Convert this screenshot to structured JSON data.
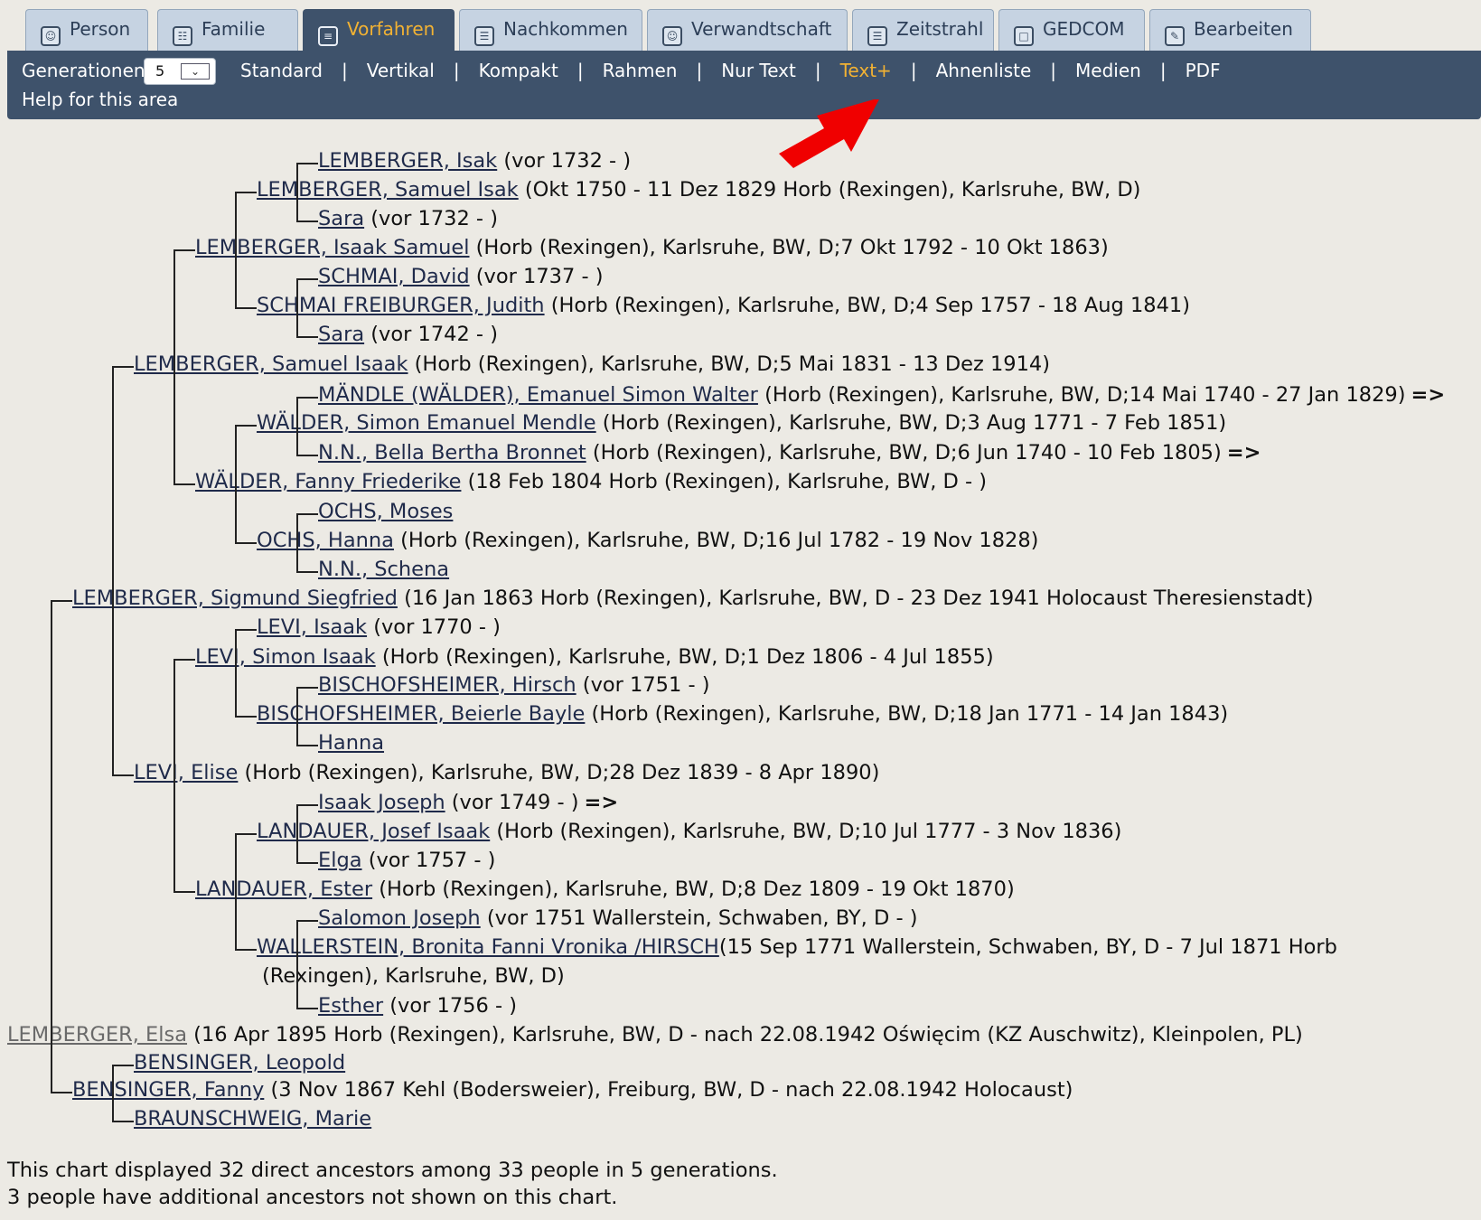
{
  "tabs": [
    {
      "label": "Person",
      "icon": "person-icon",
      "glyph": "☺"
    },
    {
      "label": "Familie",
      "icon": "family-icon",
      "glyph": "☷"
    },
    {
      "label": "Vorfahren",
      "icon": "ancestors-icon",
      "glyph": "≡"
    },
    {
      "label": "Nachkommen",
      "icon": "descendants-icon",
      "glyph": "☰"
    },
    {
      "label": "Verwandtschaft",
      "icon": "relationship-icon",
      "glyph": "☺"
    },
    {
      "label": "Zeitstrahl",
      "icon": "timeline-icon",
      "glyph": "☰"
    },
    {
      "label": "GEDCOM",
      "icon": "gedcom-icon",
      "glyph": "□"
    },
    {
      "label": "Bearbeiten",
      "icon": "edit-icon",
      "glyph": "✎"
    }
  ],
  "active_tab": "Vorfahren",
  "toolbar": {
    "generations_label": "Generationen:",
    "generations_value": "5",
    "views": [
      "Standard",
      "Vertikal",
      "Kompakt",
      "Rahmen",
      "Nur Text",
      "Text+",
      "Ahnenliste",
      "Medien",
      "PDF"
    ],
    "selected_view": "Text+",
    "separator": "|",
    "help": "Help for this area"
  },
  "colors": {
    "tab_bg": "#c6d3e2",
    "active_tab_bg": "#3e526b",
    "active_text": "#f2b233",
    "toolbar_bg": "#3e526b",
    "arrow": "#f00000"
  },
  "tree": [
    {
      "name": "LEMBERGER, Isak",
      "info": " (vor 1732 - )"
    },
    {
      "name": "LEMBERGER, Samuel Isak",
      "info": " (Okt 1750 - 11 Dez 1829 Horb (Rexingen), Karlsruhe, BW, D)"
    },
    {
      "name": "Sara",
      "info": " (vor 1732 - )"
    },
    {
      "name": "LEMBERGER, Isaak Samuel",
      "info": " (Horb (Rexingen), Karlsruhe, BW, D;7 Okt 1792 - 10 Okt 1863)"
    },
    {
      "name": "SCHMAI, David",
      "info": " (vor 1737 - )"
    },
    {
      "name": "SCHMAI FREIBURGER, Judith",
      "info": " (Horb (Rexingen), Karlsruhe, BW, D;4 Sep 1757 - 18 Aug 1841)"
    },
    {
      "name": "Sara",
      "info": " (vor 1742 - )"
    },
    {
      "name": "LEMBERGER, Samuel Isaak",
      "info": " (Horb (Rexingen), Karlsruhe, BW, D;5 Mai 1831 - 13 Dez 1914)"
    },
    {
      "name": "MÄNDLE (WÄLDER), Emanuel Simon Walter",
      "info": " (Horb (Rexingen), Karlsruhe, BW, D;14 Mai 1740 - 27 Jan 1829)",
      "more": "=>"
    },
    {
      "name": "WÄLDER, Simon Emanuel Mendle",
      "info": " (Horb (Rexingen), Karlsruhe, BW, D;3 Aug 1771 - 7 Feb 1851)"
    },
    {
      "name": "N.N., Bella Bertha Bronnet",
      "info": " (Horb (Rexingen), Karlsruhe, BW, D;6 Jun 1740 - 10 Feb 1805)",
      "more": "=>"
    },
    {
      "name": "WÄLDER, Fanny Friederike",
      "info": " (18 Feb 1804 Horb (Rexingen), Karlsruhe, BW, D - )"
    },
    {
      "name": "OCHS, Moses",
      "info": ""
    },
    {
      "name": "OCHS, Hanna",
      "info": " (Horb (Rexingen), Karlsruhe, BW, D;16 Jul 1782 - 19 Nov 1828)"
    },
    {
      "name": "N.N., Schena",
      "info": ""
    },
    {
      "name": "LEMBERGER, Sigmund Siegfried",
      "info": " (16 Jan 1863 Horb (Rexingen), Karlsruhe, BW, D - 23 Dez 1941 Holocaust Theresienstadt)"
    },
    {
      "name": "LEVI, Isaak",
      "info": " (vor 1770 - )"
    },
    {
      "name": "LEVI, Simon Isaak",
      "info": " (Horb (Rexingen), Karlsruhe, BW, D;1 Dez 1806 - 4 Jul 1855)"
    },
    {
      "name": "BISCHOFSHEIMER, Hirsch",
      "info": " (vor 1751 - )"
    },
    {
      "name": "BISCHOFSHEIMER, Beierle Bayle",
      "info": " (Horb (Rexingen), Karlsruhe, BW, D;18 Jan 1771 - 14 Jan 1843)"
    },
    {
      "name": "Hanna",
      "info": ""
    },
    {
      "name": "LEVI, Elise",
      "info": " (Horb (Rexingen), Karlsruhe, BW, D;28 Dez 1839 - 8 Apr 1890)"
    },
    {
      "name": "Isaak Joseph",
      "info": " (vor 1749 - )",
      "more": "=>"
    },
    {
      "name": "LANDAUER, Josef Isaak",
      "info": " (Horb (Rexingen), Karlsruhe, BW, D;10 Jul 1777 - 3 Nov 1836)"
    },
    {
      "name": "Elga",
      "info": " (vor 1757 - )"
    },
    {
      "name": "LANDAUER, Ester",
      "info": " (Horb (Rexingen), Karlsruhe, BW, D;8 Dez 1809 - 19 Okt 1870)"
    },
    {
      "name": "Salomon Joseph",
      "info": " (vor 1751 Wallerstein, Schwaben, BY, D - )"
    },
    {
      "name": "WALLERSTEIN, Bronita Fanni Vronika /HIRSCH",
      "info": "(15 Sep 1771 Wallerstein, Schwaben, BY, D - 7 Jul 1871 Horb"
    },
    {
      "name": "",
      "info": "(Rexingen), Karlsruhe, BW, D)"
    },
    {
      "name": "Esther",
      "info": " (vor 1756 - )"
    },
    {
      "name": "LEMBERGER, Elsa",
      "info": " (16 Apr 1895 Horb (Rexingen), Karlsruhe, BW, D - nach 22.08.1942 Oświęcim (KZ Auschwitz), Kleinpolen, PL)"
    },
    {
      "name": "BENSINGER, Leopold",
      "info": ""
    },
    {
      "name": "BENSINGER, Fanny",
      "info": " (3 Nov 1867 Kehl (Bodersweier), Freiburg, BW, D - nach 22.08.1942 Holocaust)"
    },
    {
      "name": "BRAUNSCHWEIG, Marie",
      "info": ""
    }
  ],
  "footer": {
    "line1": "This chart displayed 32 direct ancestors among 33 people in 5 generations.",
    "line2": "3 people have additional ancestors not shown on this chart."
  }
}
